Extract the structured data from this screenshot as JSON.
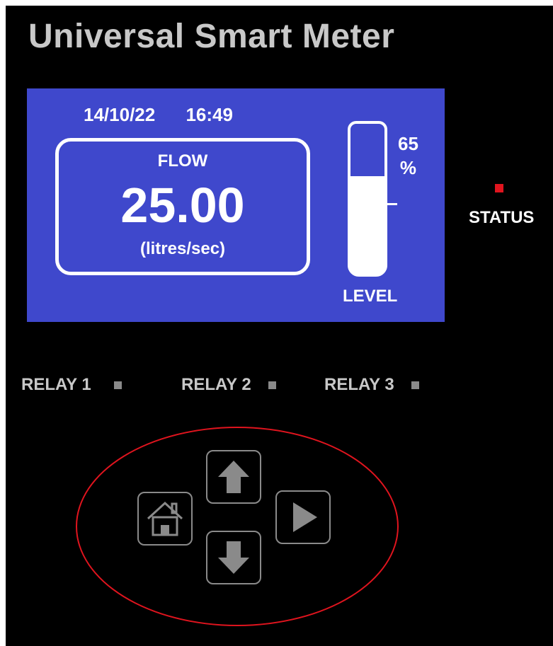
{
  "title": "Universal Smart Meter",
  "display": {
    "date": "14/10/22",
    "time": "16:49",
    "flow_label": "FLOW",
    "flow_value": "25.00",
    "flow_unit": "(litres/sec)",
    "level_value": "65",
    "level_unit": "%",
    "level_fraction": 0.65,
    "level_label": "LEVEL"
  },
  "status": {
    "label": "STATUS",
    "led_color": "#e0141e"
  },
  "relays": [
    {
      "label": "RELAY 1",
      "led_color": "#8a8a8a"
    },
    {
      "label": "RELAY 2",
      "led_color": "#8a8a8a"
    },
    {
      "label": "RELAY 3",
      "led_color": "#8a8a8a"
    }
  ],
  "keypad": {
    "ring_color": "#e0141e",
    "buttons": [
      {
        "icon": "arrow-up-icon"
      },
      {
        "icon": "home-icon"
      },
      {
        "icon": "play-icon"
      },
      {
        "icon": "arrow-down-icon"
      }
    ]
  },
  "colors": {
    "screen": "#3f48cc",
    "text_light": "#ffffff",
    "text_grey": "#c8c8c8",
    "key_grey": "#8a8a8a"
  }
}
